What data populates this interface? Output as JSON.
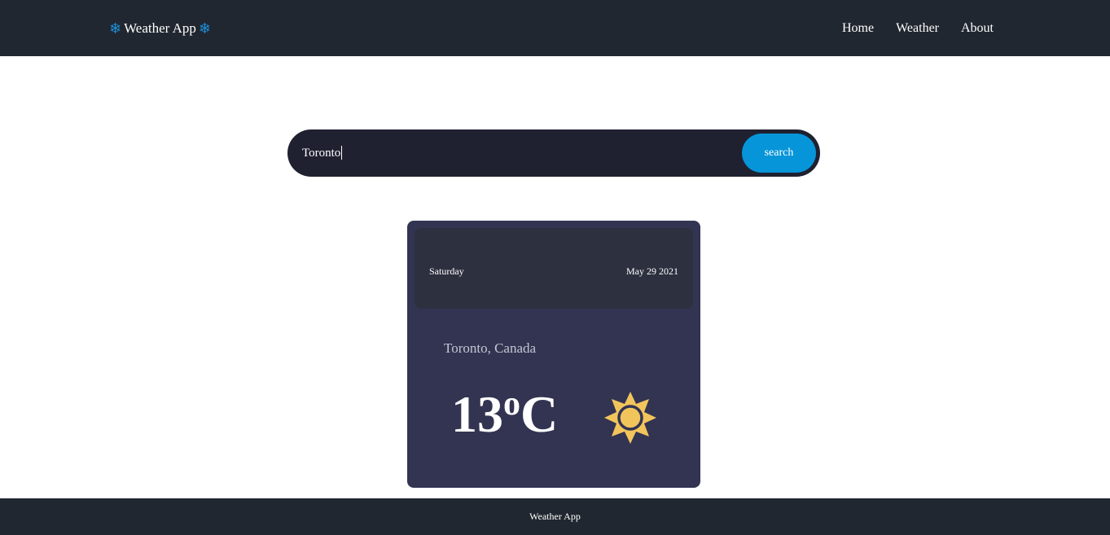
{
  "header": {
    "brand": {
      "icon_left": "❄",
      "text": "Weather App",
      "icon_right": "❄",
      "icon_name": "snowflake-icon",
      "icon_color": "#1e8fd9"
    },
    "nav": [
      {
        "label": "Home"
      },
      {
        "label": "Weather"
      },
      {
        "label": "About"
      }
    ]
  },
  "search": {
    "value": "Toronto",
    "button_label": "search",
    "button_color": "#0795d9"
  },
  "weather_card": {
    "day": "Saturday",
    "date": "May 29 2021",
    "location": "Toronto, Canada",
    "temperature": "13",
    "temperature_unit_degree": "o",
    "temperature_unit": "C",
    "condition_icon": "sun-icon",
    "icon_color": "#f2c55c"
  },
  "footer": {
    "text": "Weather App"
  },
  "colors": {
    "navbar_bg": "#212730",
    "search_bg": "#1f2030",
    "card_bg": "#333452",
    "card_header_bg": "#2d303f"
  }
}
